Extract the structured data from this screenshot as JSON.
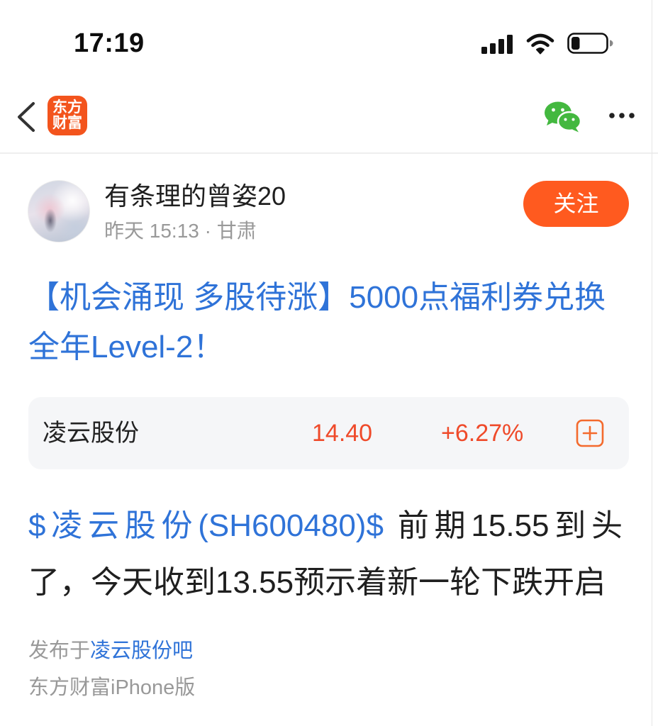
{
  "status_bar": {
    "time": "17:19",
    "signal_bars": 4,
    "battery_level": 0.25,
    "icons": {
      "signal": "cellular-signal-icon",
      "wifi": "wifi-icon",
      "battery": "battery-icon"
    }
  },
  "nav": {
    "logo_text": [
      "东方",
      "财富"
    ],
    "icons": {
      "back": "chevron-left-icon",
      "share": "wechat-icon",
      "more": "more-dots-icon"
    }
  },
  "author": {
    "name": "有条理的曾姿20",
    "meta": "昨天 15:13 · 甘肃",
    "follow_label": "关注"
  },
  "post": {
    "title": "【机会涌现 多股待涨】5000点福利券兑换全年Level-2！",
    "stock_card": {
      "name": "凌云股份",
      "price": "14.40",
      "change": "+6.27%",
      "action_icon": "plus-square-icon"
    },
    "body": {
      "stock_tag": "$凌云股份(SH600480)$",
      "text": "前期15.55到头了，今天收到13.55预示着新一轮下跌开启"
    },
    "published": {
      "prefix": "发布于",
      "forum": "凌云股份吧"
    },
    "source": "东方财富iPhone版"
  },
  "colors": {
    "brand_orange": "#F3541D",
    "follow_button": "#FF5A1F",
    "link_blue": "#2F73D8",
    "price_up": "#EF4A2A",
    "wechat_green": "#43B83F",
    "muted_text": "#999999",
    "add_icon": "#F46A2D"
  }
}
